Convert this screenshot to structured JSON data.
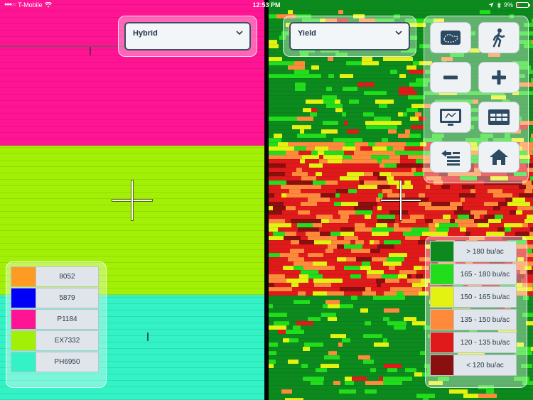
{
  "status_bar": {
    "carrier": "T-Mobile",
    "time": "12:53 PM",
    "battery": "9%"
  },
  "left_panel": {
    "layer_select": {
      "selected": "Hybrid"
    },
    "legend": [
      {
        "label": "8052",
        "color": "#ff9a22"
      },
      {
        "label": "5879",
        "color": "#0000f8"
      },
      {
        "label": "P1184",
        "color": "#ff1493"
      },
      {
        "label": "EX7332",
        "color": "#a3f007"
      },
      {
        "label": "PH6950",
        "color": "#33f2c6"
      }
    ]
  },
  "right_panel": {
    "layer_select": {
      "selected": "Yield"
    },
    "toolbar": [
      {
        "name": "field-boundary-button",
        "icon": "map-icon"
      },
      {
        "name": "walk-mode-button",
        "icon": "walking-person-icon"
      },
      {
        "name": "zoom-out-button",
        "icon": "minus-icon"
      },
      {
        "name": "zoom-in-button",
        "icon": "plus-icon"
      },
      {
        "name": "map-view-button",
        "icon": "screen-map-icon"
      },
      {
        "name": "data-table-button",
        "icon": "table-icon"
      },
      {
        "name": "layers-list-button",
        "icon": "list-arrow-icon"
      },
      {
        "name": "home-button",
        "icon": "home-icon"
      }
    ],
    "legend": [
      {
        "label": "> 180 bu/ac",
        "color": "#0c8a1e"
      },
      {
        "label": "165 - 180 bu/ac",
        "color": "#22dd1c"
      },
      {
        "label": "150 - 165 bu/ac",
        "color": "#e4f212"
      },
      {
        "label": "135 - 150 bu/ac",
        "color": "#ff8a3c"
      },
      {
        "label": "120 - 135 bu/ac",
        "color": "#e01a1a"
      },
      {
        "label": "< 120 bu/ac",
        "color": "#8a0f0f"
      }
    ]
  }
}
